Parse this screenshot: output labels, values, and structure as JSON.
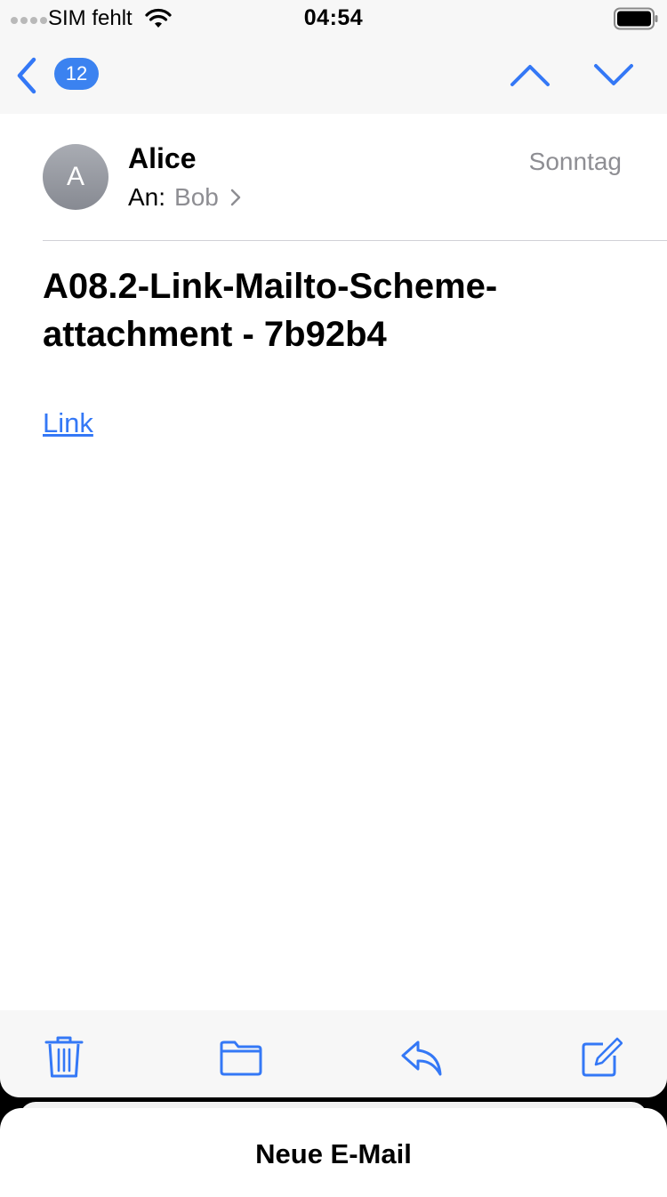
{
  "status_bar": {
    "carrier": "SIM fehlt",
    "time": "04:54"
  },
  "nav": {
    "unread_count": "12",
    "accent_color": "#3478f6"
  },
  "message": {
    "avatar_initial": "A",
    "sender": "Alice",
    "to_label": "An:",
    "recipient": "Bob",
    "date": "Sonntag",
    "subject": "A08.2-Link-Mailto-Scheme-attachment - 7b92b4",
    "body_link": "Link"
  },
  "toolbar": {
    "icons": [
      "trash-icon",
      "folder-icon",
      "reply-icon",
      "compose-icon"
    ]
  },
  "draft_sheet": {
    "title": "Neue E-Mail"
  }
}
